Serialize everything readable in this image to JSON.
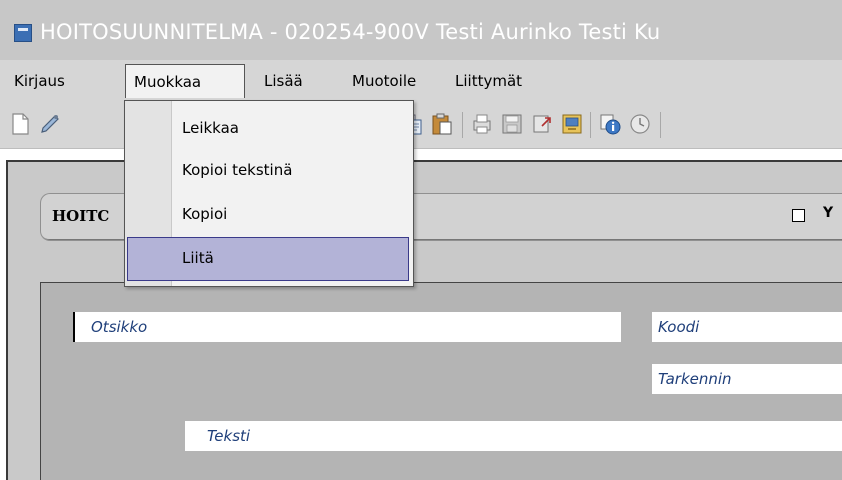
{
  "window": {
    "title": "HOITOSUUNNITELMA - 020254-900V Testi Aurinko Testi Ku"
  },
  "menubar": {
    "items": [
      "Kirjaus",
      "Muokkaa",
      "Lisää",
      "Muotoile",
      "Liittymät"
    ],
    "active": "Muokkaa"
  },
  "dropdown": {
    "items": [
      "Leikkaa",
      "Kopioi tekstinä",
      "Kopioi",
      "Liitä"
    ],
    "highlighted": "Liitä"
  },
  "section": {
    "title": "HOITC",
    "checkbox_label": "Y",
    "checkbox_checked": false
  },
  "form": {
    "otsikko_label": "Otsikko",
    "koodi_label": "Koodi",
    "tarkennin_label": "Tarkennin",
    "teksti_label": "Teksti"
  },
  "toolbar": {
    "icons": [
      "new-document-icon",
      "edit-icon",
      "copy-icon",
      "paste-icon",
      "print-icon",
      "save-icon",
      "export-icon",
      "import-icon",
      "info-icon",
      "history-icon"
    ]
  }
}
